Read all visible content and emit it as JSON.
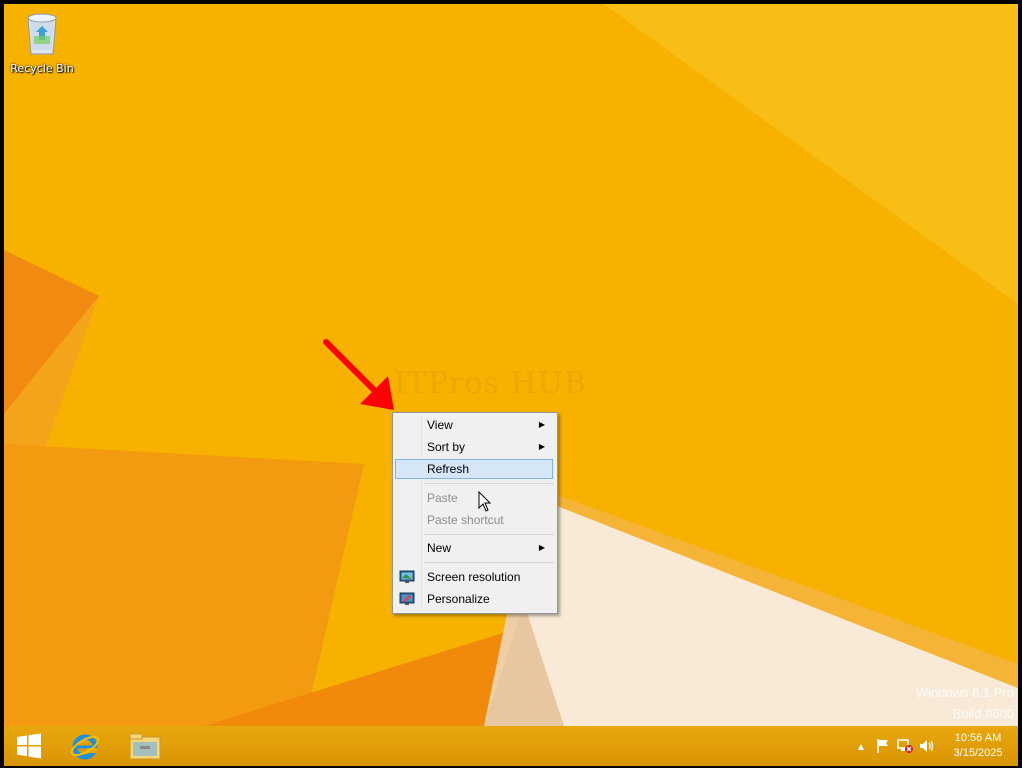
{
  "desktop": {
    "recycle_bin_label": "Recycle Bin",
    "watermark": "ITPros HUB",
    "os_name": "Windows 8.1 Pro",
    "os_build": "Build 9600"
  },
  "context_menu": {
    "items": [
      {
        "label": "View",
        "submenu": true,
        "enabled": true
      },
      {
        "label": "Sort by",
        "submenu": true,
        "enabled": true
      },
      {
        "label": "Refresh",
        "submenu": false,
        "enabled": true,
        "highlighted": true
      },
      {
        "label": "Paste",
        "submenu": false,
        "enabled": false
      },
      {
        "label": "Paste shortcut",
        "submenu": false,
        "enabled": false
      },
      {
        "label": "New",
        "submenu": true,
        "enabled": true
      },
      {
        "label": "Screen resolution",
        "submenu": false,
        "enabled": true,
        "icon": "display-icon"
      },
      {
        "label": "Personalize",
        "submenu": false,
        "enabled": true,
        "icon": "personalize-icon"
      }
    ],
    "submenu_arrow": "▶"
  },
  "taskbar": {
    "pinned": [
      "start-icon",
      "internet-explorer-icon",
      "file-explorer-icon"
    ],
    "tray_icons": [
      "show-hidden-icons-icon",
      "action-center-flag-icon",
      "network-disconnected-icon",
      "volume-icon"
    ],
    "tray_chevron": "▲",
    "clock_time": "10:56 AM",
    "clock_date": "3/15/2025"
  },
  "colors": {
    "background": "#f6b000",
    "taskbar": "#e09e08",
    "menu_highlight": "#d5e6f7",
    "annotation_arrow": "#ff0000"
  }
}
